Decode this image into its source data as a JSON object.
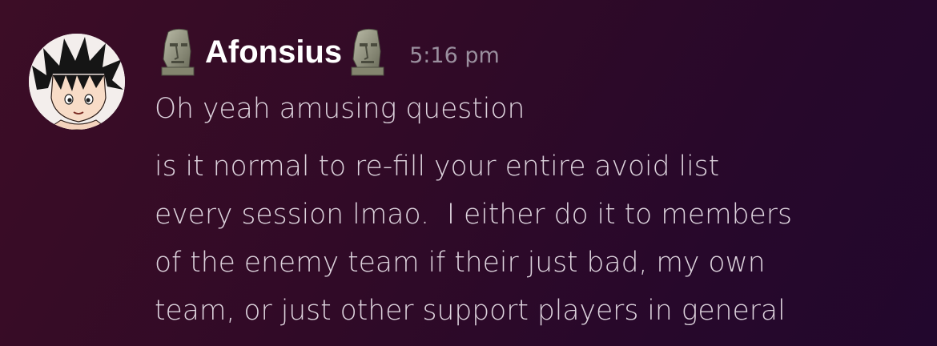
{
  "message": {
    "author": "Afonsius",
    "timestamp": "5:16 pm",
    "decorations": [
      "moai-icon",
      "moai-icon"
    ],
    "avatar": "goku-avatar",
    "paragraphs": [
      {
        "lines": [
          "Oh yeah amusing question"
        ]
      },
      {
        "lines": [
          "is it normal to re-fill your entire avoid list",
          "every session lmao.  I either do it to members",
          "of the enemy team if their just bad, my own",
          "team, or just other support players in general"
        ]
      }
    ]
  },
  "colors": {
    "background_start": "#3c0d26",
    "background_end": "#22072d",
    "username": "#ffffff",
    "timestamp": "#9a8f9e",
    "text": "#ddd3dd"
  }
}
